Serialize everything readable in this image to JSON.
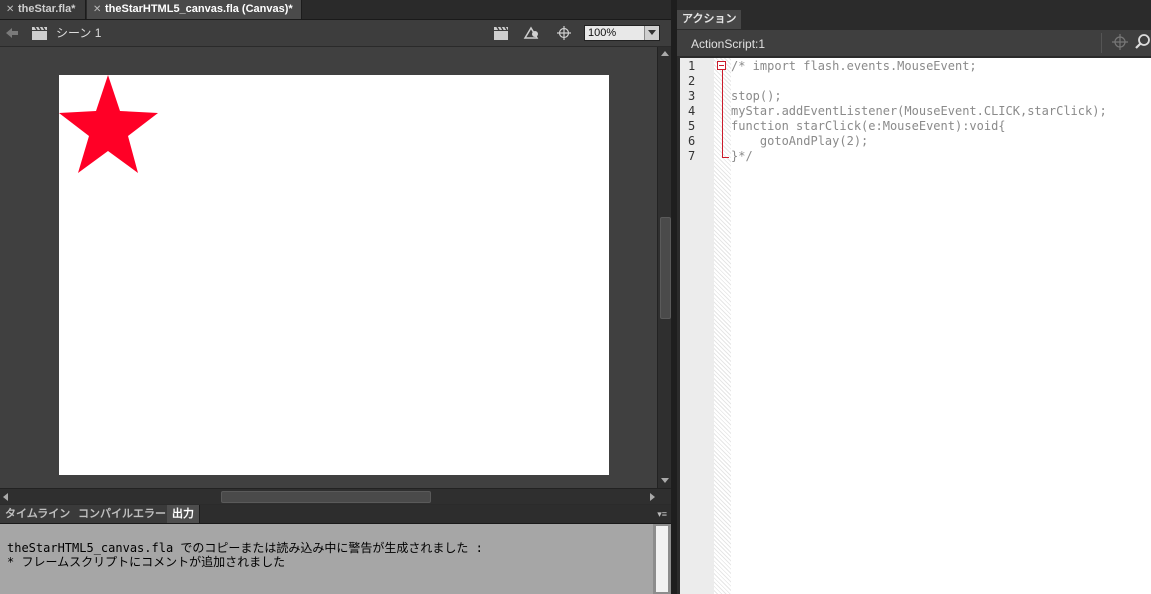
{
  "document": {
    "tabs": [
      {
        "label": "theStar.fla*",
        "active": false
      },
      {
        "label": "theStarHTML5_canvas.fla (Canvas)*",
        "active": true
      }
    ],
    "scene_label": "シーン 1",
    "zoom": "100%",
    "stage_color": "#ffffff",
    "star_color": "#ff0026"
  },
  "bottom_panel": {
    "tabs": [
      {
        "label": "タイムライン",
        "active": false
      },
      {
        "label": "コンパイルエラー",
        "active": false
      },
      {
        "label": "出力",
        "active": true
      }
    ],
    "output_lines": [
      "theStarHTML5_canvas.fla でのコピーまたは読み込み中に警告が生成されました :",
      "* フレームスクリプトにコメントが追加されました"
    ]
  },
  "actions_panel": {
    "title": "アクション",
    "script_label": "ActionScript:1",
    "line_numbers": [
      "1",
      "2",
      "3",
      "4",
      "5",
      "6",
      "7"
    ],
    "code_lines": [
      "/* import flash.events.MouseEvent;",
      "",
      "stop();",
      "myStar.addEventListener(MouseEvent.CLICK,starClick);",
      "function starClick(e:MouseEvent):void{",
      "    gotoAndPlay(2);",
      "}*/"
    ]
  }
}
